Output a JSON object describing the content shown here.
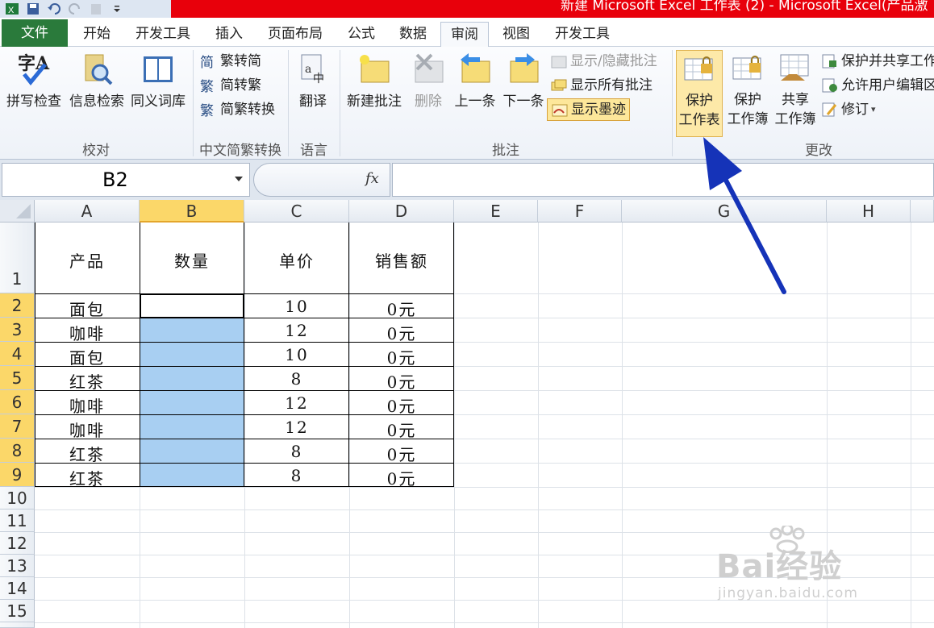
{
  "title_bar": {
    "title": "新建 Microsoft Excel 工作表 (2) - Microsoft Excel(产品激"
  },
  "tabs": [
    {
      "label": "文件"
    },
    {
      "label": "开始"
    },
    {
      "label": "开发工具"
    },
    {
      "label": "插入"
    },
    {
      "label": "页面布局"
    },
    {
      "label": "公式"
    },
    {
      "label": "数据"
    },
    {
      "label": "审阅"
    },
    {
      "label": "视图"
    },
    {
      "label": "开发工具"
    }
  ],
  "ribbon": {
    "proofing": {
      "label": "校对",
      "spelling": "拼写检查",
      "research": "信息检索",
      "thesaurus": "同义词库"
    },
    "chinese_conversion": {
      "label": "中文简繁转换",
      "to_simplified": "繁转简",
      "to_traditional": "简转繁",
      "convert": "简繁转换"
    },
    "language": {
      "label": "语言",
      "translate": "翻译"
    },
    "comments": {
      "label": "批注",
      "new": "新建批注",
      "delete": "删除",
      "previous": "上一条",
      "next": "下一条",
      "show_hide": "显示/隐藏批注",
      "show_all": "显示所有批注",
      "show_ink": "显示墨迹"
    },
    "changes": {
      "label": "更改",
      "protect_sheet_1": "保护",
      "protect_sheet_2": "工作表",
      "protect_workbook_1": "保护",
      "protect_workbook_2": "工作簿",
      "share_workbook_1": "共享",
      "share_workbook_2": "工作簿",
      "protect_share": "保护并共享工作",
      "allow_edit": "允许用户编辑区",
      "track_changes": "修订"
    }
  },
  "formula_bar": {
    "name_box": "B2",
    "fx": "fx",
    "formula": ""
  },
  "sheet": {
    "columns": [
      "A",
      "B",
      "C",
      "D",
      "E",
      "F",
      "G",
      "H"
    ],
    "rows": [
      "1",
      "2",
      "3",
      "4",
      "5",
      "6",
      "7",
      "8",
      "9",
      "10",
      "11",
      "12",
      "13",
      "14",
      "15"
    ],
    "headers": [
      "产品",
      "数量",
      "单价",
      "销售额"
    ],
    "data": [
      {
        "product": "面包",
        "qty": "",
        "price": "10",
        "sales": "0元"
      },
      {
        "product": "咖啡",
        "qty": "",
        "price": "12",
        "sales": "0元"
      },
      {
        "product": "面包",
        "qty": "",
        "price": "10",
        "sales": "0元"
      },
      {
        "product": "红茶",
        "qty": "",
        "price": "8",
        "sales": "0元"
      },
      {
        "product": "咖啡",
        "qty": "",
        "price": "12",
        "sales": "0元"
      },
      {
        "product": "咖啡",
        "qty": "",
        "price": "12",
        "sales": "0元"
      },
      {
        "product": "红茶",
        "qty": "",
        "price": "8",
        "sales": "0元"
      },
      {
        "product": "红茶",
        "qty": "",
        "price": "8",
        "sales": "0元"
      }
    ]
  },
  "watermark": {
    "brand": "Bai经验",
    "url": "jingyan.baidu.com"
  },
  "colors": {
    "file_tab": "#2a7a3b",
    "title_red": "#e8000b",
    "selection_fill": "#a8cff2",
    "header_selected": "#fbd769",
    "arrow": "#1533b8"
  }
}
